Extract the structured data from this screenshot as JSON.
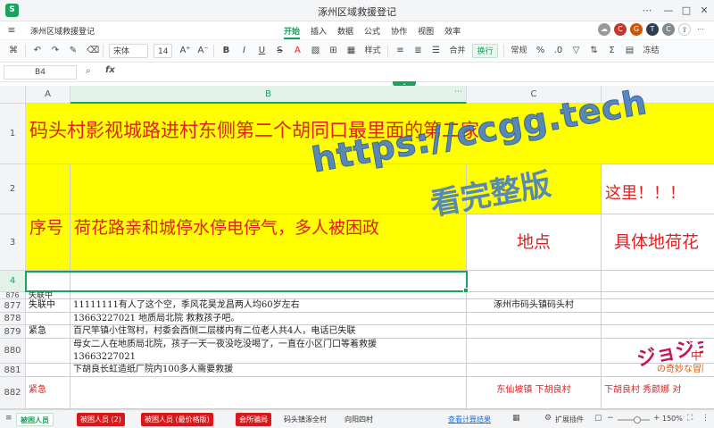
{
  "titlebar": {
    "title": "涿州区域救援登记"
  },
  "menubar": {
    "doc_name": "涿州区域救援登记",
    "tabs": [
      "开始",
      "插入",
      "数据",
      "公式",
      "协作",
      "视图",
      "效率"
    ]
  },
  "toolbar": {
    "font": "宋体",
    "font_size": "14",
    "style": "样式",
    "merge": "合并",
    "wrap": "换行",
    "format": "常规",
    "misc": "冻结"
  },
  "formulabar": {
    "cell_ref": "B4",
    "fx": "fx",
    "formula": ""
  },
  "columns": [
    "A",
    "B",
    "C"
  ],
  "rows": {
    "r1": {
      "num": "1",
      "text": "码头村影视城路进村东侧第二个胡同口最里面的第二家"
    },
    "r2": {
      "num": "2",
      "d": "这里！！！"
    },
    "r3": {
      "num": "3",
      "a": "序号",
      "b": "荷花路亲和城停水停电停气，多人被困政",
      "c": "地点",
      "d": "具体地荷花"
    },
    "r4": {
      "num": "4"
    },
    "r876": {
      "num": "876",
      "a": "失联中"
    },
    "r877": {
      "num": "877",
      "a": "失联中",
      "b": "11111111有人了这个空，季风花昊龙昌两人均60岁左右",
      "c": "涿州市码头镇码头村"
    },
    "r878": {
      "num": "878",
      "b": "13663227021  地质局北院  救救孩子吧。"
    },
    "r879": {
      "num": "879",
      "a": "紧急",
      "b": "百尺竿镇小住驾村，村委会西侧二层楼内有二位老人共4人，电话已失联"
    },
    "r880": {
      "num": "880",
      "b1": "母女二人在地质局北院，孩子一天一夜没吃没喝了，一直在小区门口等着救援",
      "b2": "13663227021"
    },
    "r881": {
      "num": "881",
      "b": "下胡良长虹造纸厂院内100多人需要救援"
    },
    "r882": {
      "num": "882",
      "a": "紧急",
      "c": "东仙坡镇  下胡良村",
      "d": "下胡良村  秀颜娜  对"
    }
  },
  "watermark": {
    "line1": "https://ccgg.tech",
    "line2": "看完整版"
  },
  "sheets": [
    "被困人员",
    "被困人员 (2)",
    "被困人员 (最价格版)",
    "会所骗局",
    "码头镇涿全村",
    "向阳四村"
  ],
  "statusbar": {
    "link": "查看计算结果",
    "ext": "扩展插件",
    "zoom": "150%"
  },
  "colors": {
    "accent": "#1aa35e",
    "highlight": "#ffff00",
    "red_text": "#e02020",
    "watermark": "#4a7ec4"
  }
}
